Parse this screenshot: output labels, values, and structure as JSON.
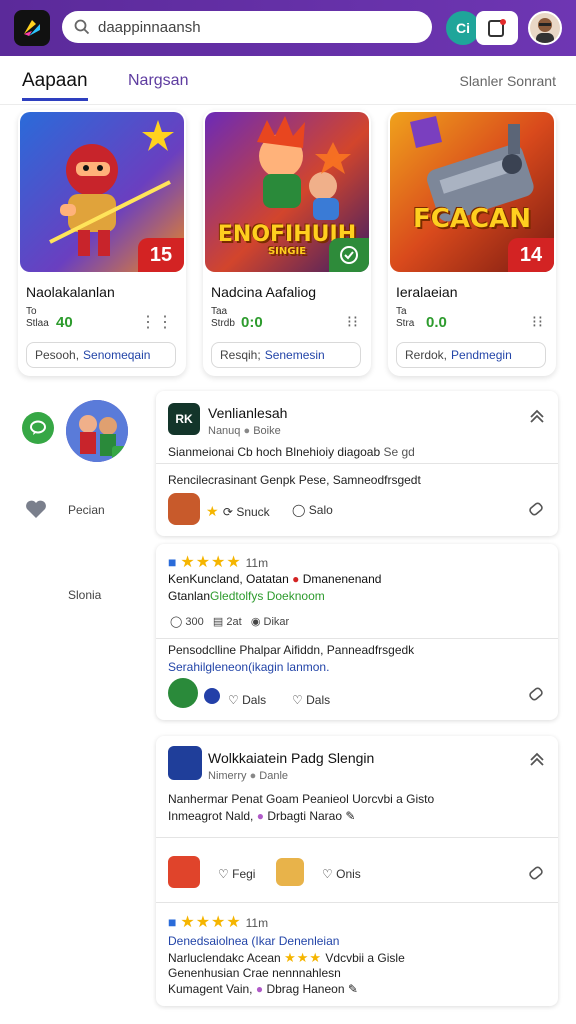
{
  "header": {
    "search_placeholder": "daappinnaansh",
    "search_value": "daappinnaansh",
    "cta_badge": "Ci"
  },
  "tabs": {
    "active": "Aapaan",
    "second": "Nargsan",
    "right": "Slanler Sonrant"
  },
  "games": [
    {
      "title": "Naolakalanlan",
      "meta_top": "To",
      "meta_bottom": "Stlaa",
      "score": "40",
      "rank": "15",
      "pill_label": "Pesooh,",
      "pill_link": "Senomeqain",
      "colors": {
        "score": "#2d9b2d"
      }
    },
    {
      "title": "Nadcina Aafaliog",
      "meta_top": "Taa",
      "meta_bottom": "Strdb",
      "score": "0:0",
      "art_text": "ENOFIHUIH",
      "art_sub": "SINGIE",
      "pill_label": "Resqih;",
      "pill_link": "Senemesin",
      "colors": {
        "score": "#2d9b2d"
      }
    },
    {
      "title": "Ieralaeian",
      "meta_top": "Ta",
      "meta_bottom": "Stra",
      "score": "0.0",
      "rank": "14",
      "art_text": "FCACAN",
      "pill_label": "Rerdok,",
      "pill_link": "Pendmegin",
      "colors": {
        "score": "#2d9b2d"
      }
    }
  ],
  "rail": {
    "label_1": "Pecian",
    "label_2": "Slonia"
  },
  "feed": [
    {
      "app_icon_text": "RK",
      "title": "Venlianlesah",
      "sub_a": "Nanuq",
      "sub_b": "Boike",
      "line1": "Sianmeionai Cb hoch Blnehioiy diagoab",
      "line1_tail": "Se gd",
      "line2": "Rencilecrasinant Genpk Pese, Samneodfrsgedt",
      "act1": "Snuck",
      "act2": "Salo"
    },
    {
      "time": "11m",
      "line1": "KenKuncland, Oatatan",
      "line1_tail": "Dmanenenand",
      "line2a": "Gtanlan",
      "line2b": "Gledtolfys Doeknoom",
      "stat1": "300",
      "stat2": "2at",
      "stat3": "Dikar",
      "line3": "Pensodclline Phalpar Aifiddn, Panneadfrsgedk",
      "line4": "Serahilgleneon(ikagin lanmon.",
      "act1": "Dals",
      "act2": "Dals"
    },
    {
      "title": "Wolkkaiatein Padg Slengin",
      "sub_a": "Nimerry",
      "sub_b": "Danle",
      "line1": "Nanhermar Penat Goam Peanieol Uorcvbi a Gisto",
      "line2": "Inmeagrot Nald,",
      "line2_tail": "Drbagti Narao",
      "act1": "Fegi",
      "act2": "Onis",
      "time": "11m",
      "line3": "Denedsaiolnea (Ikar Denenleian",
      "line4": "Narluclendakc Acean",
      "line4_tail": "Vdcvbii a Gisle",
      "line5": "Genenhusian Crae nennnahlesn",
      "line6": "Kumagent Vain,",
      "line6_tail": "Dbrag Haneon"
    }
  ]
}
